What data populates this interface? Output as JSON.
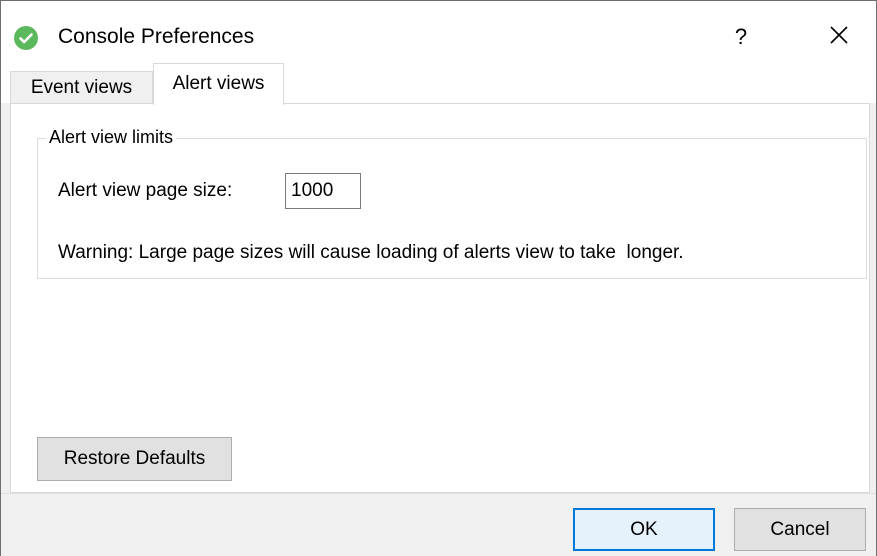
{
  "window": {
    "title": "Console Preferences",
    "help_glyph": "?",
    "app_icon": "green-checkmark-circle-icon",
    "close_icon": "close-icon"
  },
  "tabs": [
    {
      "label": "Event views",
      "active": false
    },
    {
      "label": "Alert views",
      "active": true
    }
  ],
  "alert_view_limits": {
    "group_title": "Alert view limits",
    "page_size_label": "Alert view page size:",
    "page_size_value": "1000",
    "warning": "Warning: Large page sizes will cause loading of alerts view to take  longer."
  },
  "buttons": {
    "restore_defaults": "Restore Defaults",
    "ok": "OK",
    "cancel": "Cancel"
  },
  "colors": {
    "app_icon_green": "#5cb85c",
    "default_button_border": "#0078d7",
    "default_button_fill": "#e5f1fb"
  }
}
